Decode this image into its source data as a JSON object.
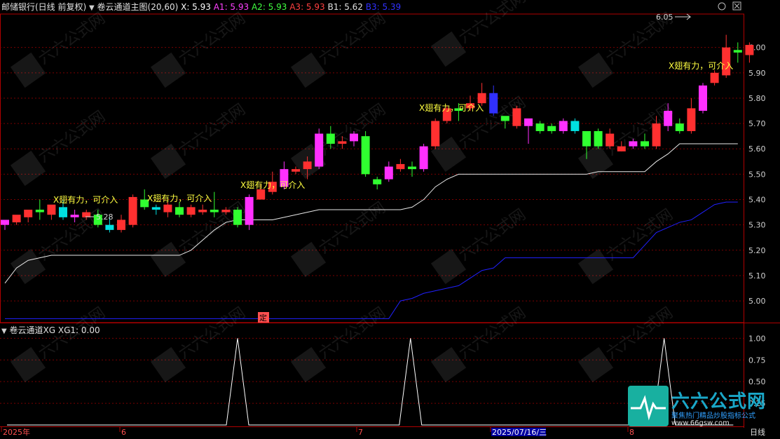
{
  "header": {
    "stock": "邮储银行(日线 前复权)",
    "indicator": "卷云通道主图(20,60)",
    "x_label": "X: 5.93",
    "a1_label": "A1: 5.93",
    "a2_label": "A2: 5.93",
    "a3_label": "A3: 5.93",
    "b1_label": "B1: 5.62",
    "b3_label": "B3: 5.39"
  },
  "sub_header": {
    "indicator": "卷云通道XG",
    "value": "XG1: 0.00"
  },
  "colors": {
    "up": "#ff3030",
    "down": "#00e0e0",
    "grid": "#7a0000",
    "frame": "#b00000",
    "axis_text": "#d0d0d0",
    "white_line": "#e8e8e8",
    "blue_line": "#2020ff",
    "label_yellow": "#ffff40",
    "x_label_color": "#ffffff",
    "a1_color": "#ff40ff",
    "a2_color": "#40ff40",
    "a3_color": "#ff4040",
    "b1_color": "#e0e0e0",
    "b3_color": "#3030ff"
  },
  "main_chart": {
    "y_ticks": [
      "6.00",
      "5.90",
      "5.80",
      "5.70",
      "5.60",
      "5.50",
      "5.40",
      "5.30",
      "5.20",
      "5.10",
      "5.00"
    ],
    "ylim": [
      4.92,
      6.06
    ],
    "peak_label": "6.05",
    "low_label": "5.28",
    "signal_texts": [
      "X翅有力，可介入",
      "X翅有力，可介入",
      "X翅有力，可介入",
      "X翅有力，可介入",
      "X翅有力，可介入"
    ],
    "marker_text": "定"
  },
  "sub_chart": {
    "y_ticks": [
      "1.00",
      "0.75",
      "0.50",
      "0.25"
    ],
    "ylim": [
      0,
      1.1
    ]
  },
  "x_axis": {
    "labels": [
      "2025年",
      "6",
      "7",
      "2025/07/16/三",
      "8"
    ],
    "period": "日线"
  },
  "watermark": {
    "brand": "六六公式网",
    "slogan": "聚焦热门精品炒股指标公式",
    "url": "www.66gsw.com"
  },
  "chart_data": {
    "type": "candlestick",
    "candles": [
      [
        5.3,
        5.32,
        5.28,
        5.32
      ],
      [
        5.31,
        5.34,
        5.3,
        5.33
      ],
      [
        5.33,
        5.36,
        5.31,
        5.34
      ],
      [
        5.36,
        5.35,
        5.32,
        5.4
      ],
      [
        5.34,
        5.38,
        5.32,
        5.37
      ],
      [
        5.37,
        5.33,
        5.32,
        5.4
      ],
      [
        5.33,
        5.34,
        5.31,
        5.36
      ],
      [
        5.33,
        5.35,
        5.32,
        5.36
      ],
      [
        5.34,
        5.3,
        5.29,
        5.36
      ],
      [
        5.3,
        5.28,
        5.27,
        5.33
      ],
      [
        5.28,
        5.32,
        5.27,
        5.34
      ],
      [
        5.3,
        5.41,
        5.29,
        5.42
      ],
      [
        5.4,
        5.37,
        5.36,
        5.44
      ],
      [
        5.37,
        5.36,
        5.34,
        5.38
      ],
      [
        5.35,
        5.38,
        5.33,
        5.39
      ],
      [
        5.37,
        5.34,
        5.33,
        5.39
      ],
      [
        5.34,
        5.37,
        5.33,
        5.38
      ],
      [
        5.35,
        5.36,
        5.34,
        5.38
      ],
      [
        5.36,
        5.35,
        5.33,
        5.43
      ],
      [
        5.35,
        5.36,
        5.34,
        5.37
      ],
      [
        5.36,
        5.3,
        5.29,
        5.37
      ],
      [
        5.3,
        5.41,
        5.28,
        5.42
      ],
      [
        5.4,
        5.44,
        5.4,
        5.46
      ],
      [
        5.43,
        5.47,
        5.42,
        5.51
      ],
      [
        5.45,
        5.52,
        5.44,
        5.55
      ],
      [
        5.51,
        5.52,
        5.5,
        5.53
      ],
      [
        5.52,
        5.55,
        5.48,
        5.57
      ],
      [
        5.53,
        5.66,
        5.52,
        5.68
      ],
      [
        5.66,
        5.62,
        5.6,
        5.69
      ],
      [
        5.62,
        5.63,
        5.6,
        5.65
      ],
      [
        5.63,
        5.66,
        5.61,
        5.67
      ],
      [
        5.65,
        5.5,
        5.49,
        5.67
      ],
      [
        5.48,
        5.46,
        5.44,
        5.49
      ],
      [
        5.48,
        5.53,
        5.47,
        5.55
      ],
      [
        5.52,
        5.54,
        5.51,
        5.56
      ],
      [
        5.53,
        5.52,
        5.49,
        5.55
      ],
      [
        5.52,
        5.61,
        5.51,
        5.62
      ],
      [
        5.61,
        5.71,
        5.6,
        5.72
      ],
      [
        5.71,
        5.76,
        5.7,
        5.77
      ],
      [
        5.76,
        5.75,
        5.71,
        5.78
      ],
      [
        5.76,
        5.78,
        5.75,
        5.81
      ],
      [
        5.78,
        5.82,
        5.77,
        5.86
      ],
      [
        5.82,
        5.74,
        5.73,
        5.85
      ],
      [
        5.73,
        5.71,
        5.68,
        5.72
      ],
      [
        5.69,
        5.76,
        5.68,
        5.77
      ],
      [
        5.69,
        5.72,
        5.62,
        5.71
      ],
      [
        5.7,
        5.67,
        5.66,
        5.71
      ],
      [
        5.69,
        5.67,
        5.66,
        5.7
      ],
      [
        5.67,
        5.71,
        5.66,
        5.72
      ],
      [
        5.71,
        5.67,
        5.66,
        5.72
      ],
      [
        5.67,
        5.61,
        5.56,
        5.67
      ],
      [
        5.67,
        5.61,
        5.6,
        5.68
      ],
      [
        5.61,
        5.66,
        5.6,
        5.68
      ],
      [
        5.59,
        5.61,
        5.59,
        5.63
      ],
      [
        5.61,
        5.63,
        5.6,
        5.64
      ],
      [
        5.63,
        5.61,
        5.6,
        5.66
      ],
      [
        5.61,
        5.7,
        5.6,
        5.73
      ],
      [
        5.69,
        5.75,
        5.67,
        5.78
      ],
      [
        5.7,
        5.67,
        5.66,
        5.72
      ],
      [
        5.67,
        5.76,
        5.66,
        5.8
      ],
      [
        5.75,
        5.85,
        5.74,
        5.86
      ],
      [
        5.86,
        5.9,
        5.85,
        5.91
      ],
      [
        5.89,
        6.0,
        5.88,
        6.05
      ],
      [
        5.99,
        5.98,
        5.94,
        6.02
      ],
      [
        5.97,
        6.01,
        5.94,
        6.02
      ]
    ],
    "white_line": [
      5.07,
      5.13,
      5.16,
      5.17,
      5.18,
      5.18,
      5.18,
      5.18,
      5.18,
      5.18,
      5.18,
      5.18,
      5.18,
      5.18,
      5.18,
      5.18,
      5.2,
      5.24,
      5.28,
      5.31,
      5.32,
      5.32,
      5.32,
      5.32,
      5.33,
      5.34,
      5.35,
      5.36,
      5.36,
      5.36,
      5.36,
      5.36,
      5.36,
      5.36,
      5.36,
      5.37,
      5.4,
      5.45,
      5.48,
      5.5,
      5.5,
      5.5,
      5.5,
      5.5,
      5.5,
      5.5,
      5.5,
      5.5,
      5.5,
      5.5,
      5.5,
      5.51,
      5.51,
      5.51,
      5.51,
      5.51,
      5.55,
      5.58,
      5.62,
      5.62,
      5.62,
      5.62,
      5.62,
      5.62
    ],
    "blue_line": [
      4.93,
      4.93,
      4.93,
      4.93,
      4.93,
      4.93,
      4.93,
      4.93,
      4.93,
      4.93,
      4.93,
      4.93,
      4.93,
      4.93,
      4.93,
      4.93,
      4.93,
      4.93,
      4.93,
      4.93,
      4.93,
      4.93,
      4.93,
      4.93,
      4.93,
      4.93,
      4.93,
      4.93,
      4.93,
      4.93,
      4.93,
      4.93,
      4.93,
      4.93,
      5.0,
      5.01,
      5.03,
      5.04,
      5.05,
      5.06,
      5.09,
      5.12,
      5.13,
      5.17,
      5.17,
      5.17,
      5.17,
      5.17,
      5.17,
      5.17,
      5.17,
      5.17,
      5.17,
      5.17,
      5.17,
      5.22,
      5.27,
      5.29,
      5.31,
      5.32,
      5.35,
      5.38,
      5.39,
      5.39
    ],
    "xg_signal": [
      0,
      0,
      0,
      0,
      0,
      0,
      0,
      0,
      0,
      0,
      0,
      0,
      0,
      0,
      0,
      0,
      0,
      0,
      0,
      0,
      1,
      0,
      0,
      0,
      0,
      0,
      0,
      0,
      0,
      0,
      0,
      0,
      0,
      0,
      0,
      1,
      0,
      0,
      0,
      0,
      0,
      0,
      0,
      0,
      0,
      0,
      0,
      0,
      0,
      0,
      0,
      0,
      0,
      0,
      0,
      0,
      0,
      1,
      0,
      0,
      0,
      0,
      0,
      0
    ]
  }
}
